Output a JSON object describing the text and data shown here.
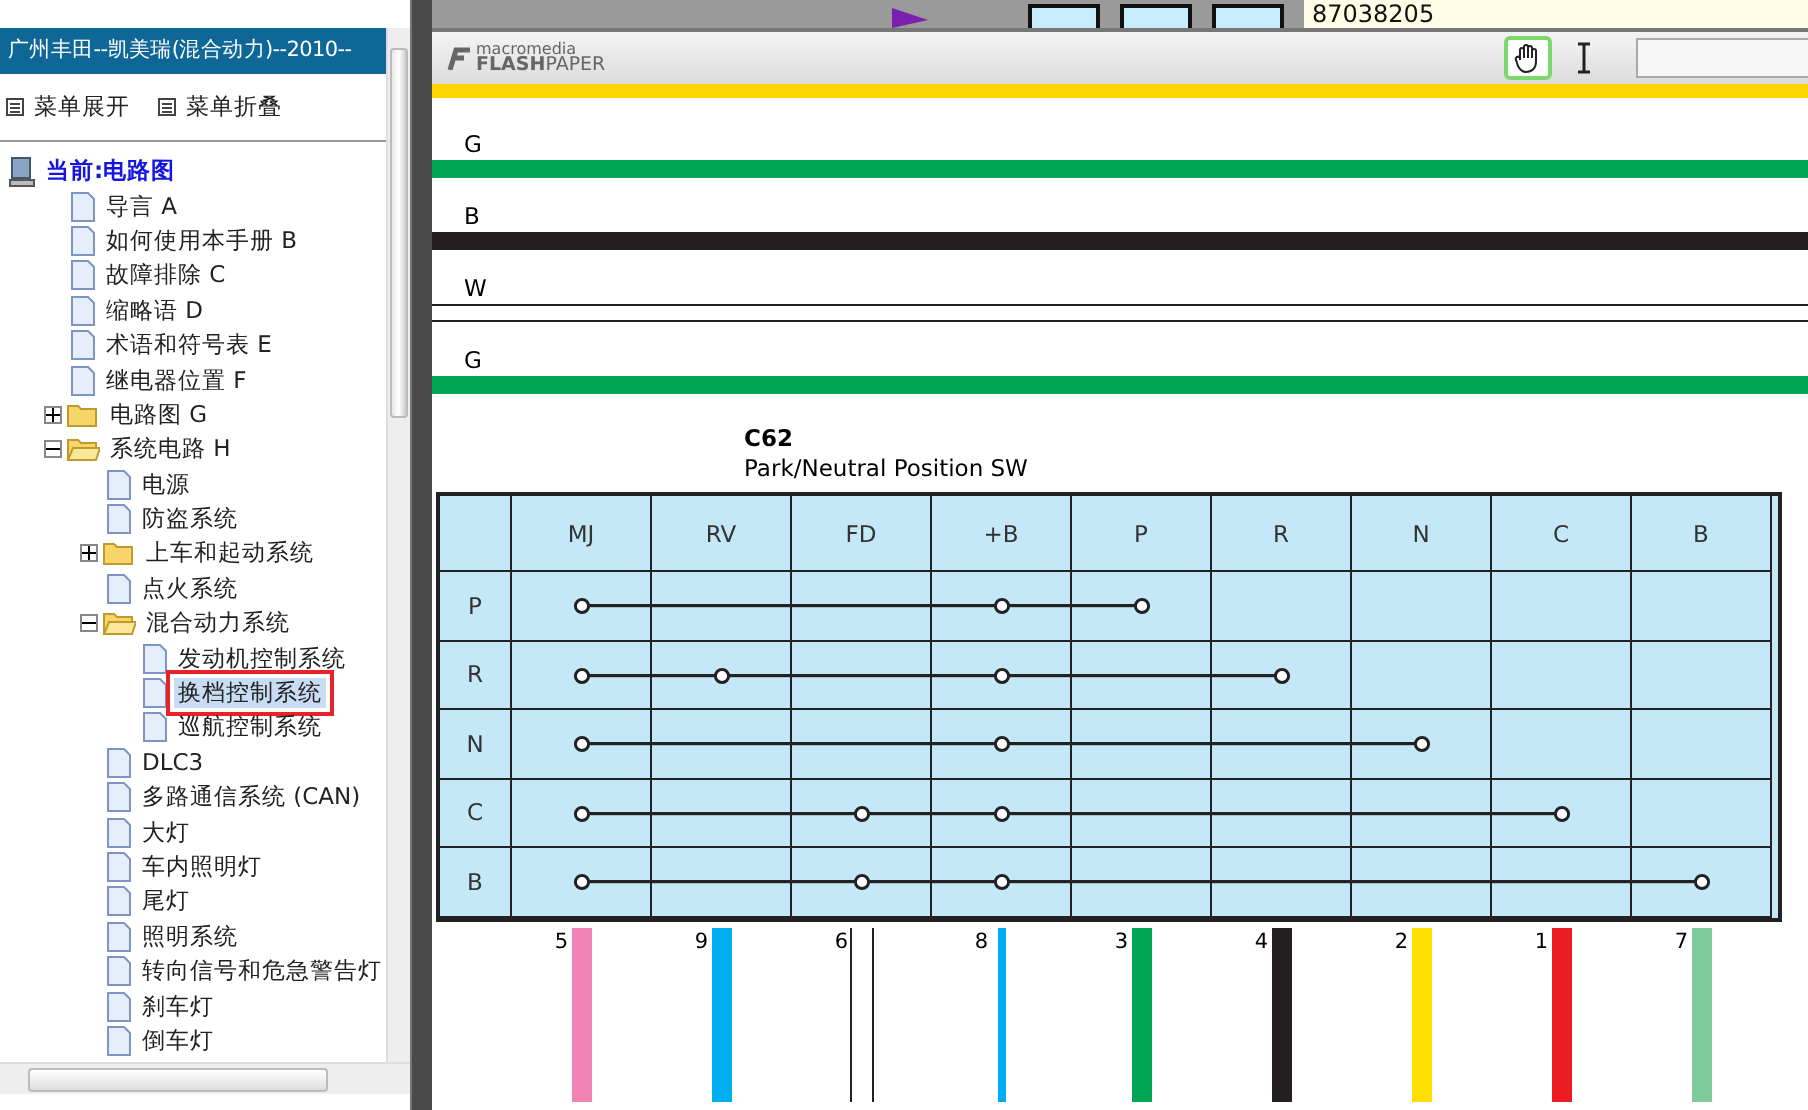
{
  "sidebar": {
    "title": "广州丰田--凯美瑞(混合动力)--2010--",
    "menu": [
      "菜单展开",
      "菜单折叠"
    ],
    "tree": [
      {
        "kind": "root",
        "label": "当前:电路图",
        "children": [
          {
            "kind": "page",
            "label": "导言 A",
            "selected": false
          },
          {
            "kind": "page",
            "label": "如何使用本手册 B",
            "selected": false
          },
          {
            "kind": "page",
            "label": "故障排除 C",
            "selected": false
          },
          {
            "kind": "page",
            "label": "缩略语 D",
            "selected": false
          },
          {
            "kind": "page",
            "label": "术语和符号表 E",
            "selected": false
          },
          {
            "kind": "page",
            "label": "继电器位置 F",
            "selected": false
          },
          {
            "kind": "folder",
            "label": "电路图 G",
            "expanded": false,
            "selected": false
          },
          {
            "kind": "folder",
            "label": "系统电路 H",
            "expanded": true,
            "selected": false,
            "children": [
              {
                "kind": "page",
                "label": "电源",
                "selected": false
              },
              {
                "kind": "page",
                "label": "防盗系统",
                "selected": false
              },
              {
                "kind": "folder",
                "label": "上车和起动系统",
                "expanded": false,
                "selected": false
              },
              {
                "kind": "page",
                "label": "点火系统",
                "selected": false
              },
              {
                "kind": "folder",
                "label": "混合动力系统",
                "expanded": true,
                "selected": false,
                "children": [
                  {
                    "kind": "page",
                    "label": "发动机控制系统",
                    "selected": false
                  },
                  {
                    "kind": "page",
                    "label": "换档控制系统",
                    "selected": true
                  },
                  {
                    "kind": "page",
                    "label": "巡航控制系统",
                    "selected": false
                  }
                ]
              },
              {
                "kind": "page",
                "label": "DLC3",
                "selected": false
              },
              {
                "kind": "page",
                "label": "多路通信系统 (CAN)",
                "selected": false
              },
              {
                "kind": "page",
                "label": "大灯",
                "selected": false
              },
              {
                "kind": "page",
                "label": "车内照明灯",
                "selected": false
              },
              {
                "kind": "page",
                "label": "尾灯",
                "selected": false
              },
              {
                "kind": "page",
                "label": "照明系统",
                "selected": false
              },
              {
                "kind": "page",
                "label": "转向信号和危急警告灯",
                "selected": false
              },
              {
                "kind": "page",
                "label": "刹车灯",
                "selected": false
              },
              {
                "kind": "page",
                "label": "倒车灯",
                "selected": false
              }
            ]
          }
        ]
      }
    ]
  },
  "viewer": {
    "page_field": "87038205",
    "logo_top": "macromedia",
    "logo_bottom": "**FLASH**PAPER",
    "tools": [
      {
        "kind": "hand",
        "selected": true
      },
      {
        "kind": "text",
        "selected": false
      }
    ],
    "top_wires": [
      {
        "label": "G",
        "color": "#00a651",
        "kind": "solid"
      },
      {
        "label": "B",
        "color": "#231f20",
        "kind": "solid"
      },
      {
        "label": "W",
        "color": "#ffffff",
        "kind": "outlined"
      },
      {
        "label": "G",
        "color": "#00a651",
        "kind": "solid"
      }
    ],
    "connector": {
      "code": "C62",
      "name": "Park/Neutral Position SW",
      "columns": [
        "MJ",
        "RV",
        "FD",
        "+B",
        "P",
        "R",
        "N",
        "C",
        "B"
      ],
      "rows": [
        {
          "label": "P",
          "connections": [
            true,
            false,
            false,
            true,
            true,
            false,
            false,
            false,
            false
          ]
        },
        {
          "label": "R",
          "connections": [
            true,
            true,
            false,
            true,
            false,
            true,
            false,
            false,
            false
          ]
        },
        {
          "label": "N",
          "connections": [
            true,
            false,
            false,
            true,
            false,
            false,
            true,
            false,
            false
          ]
        },
        {
          "label": "C",
          "connections": [
            true,
            false,
            true,
            true,
            false,
            false,
            false,
            true,
            false
          ]
        },
        {
          "label": "B",
          "connections": [
            true,
            false,
            true,
            true,
            false,
            false,
            false,
            false,
            true
          ]
        }
      ],
      "wires": [
        {
          "number": "5",
          "color": "#f084b4",
          "kind": "solid"
        },
        {
          "number": "9",
          "color": "#00aeef",
          "kind": "solid"
        },
        {
          "number": "6",
          "color": "#ffffff",
          "kind": "outlined"
        },
        {
          "number": "8",
          "color": "#00aeef",
          "kind": "thin"
        },
        {
          "number": "3",
          "color": "#00a651",
          "kind": "solid"
        },
        {
          "number": "4",
          "color": "#231f20",
          "kind": "solid"
        },
        {
          "number": "2",
          "color": "#ffde00",
          "kind": "solid"
        },
        {
          "number": "1",
          "color": "#ed1c24",
          "kind": "solid"
        },
        {
          "number": "7",
          "color": "#7fc99a",
          "kind": "solid"
        }
      ]
    }
  }
}
